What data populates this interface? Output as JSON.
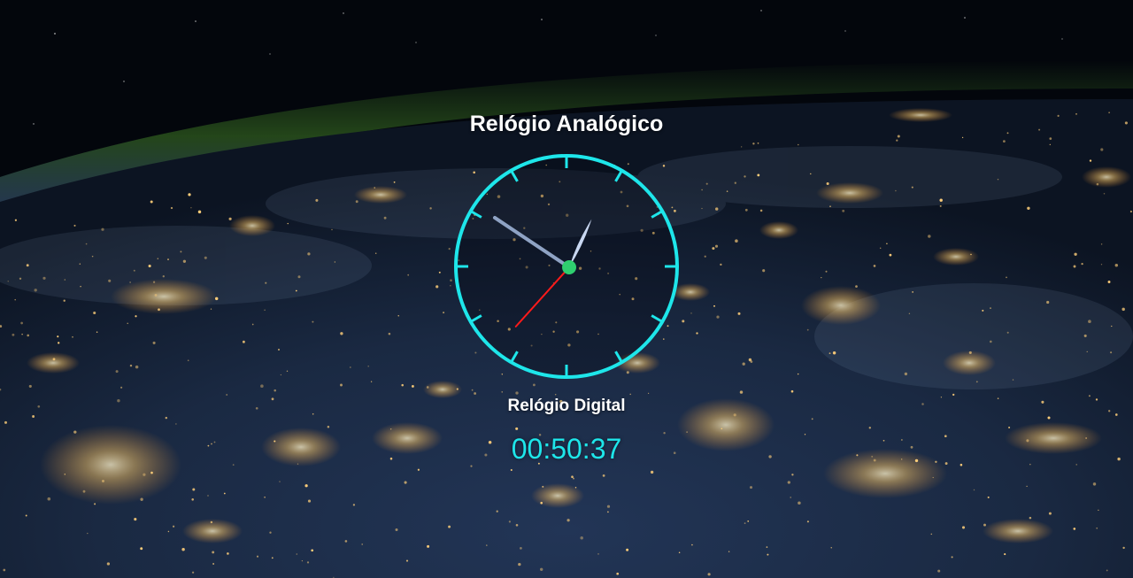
{
  "page": {
    "analog_title": "Relógio Analógico",
    "digital_title": "Relógio Digital",
    "digital_time": "00:50:37"
  },
  "clock": {
    "hours": 0,
    "minutes": 50,
    "seconds": 37,
    "ring_color": "#1ee6ea",
    "hour_hand_color": "#c9d8f2",
    "minute_hand_color": "#8fa3c4",
    "second_hand_color": "#ff1a1a",
    "center_color": "#2fcf6f"
  },
  "background": {
    "description_icon": "earth-night-from-space",
    "sky_color": "#03060c",
    "ocean_color": "#16253a",
    "atmosphere_color": "#2c5a1e",
    "city_light_color": "#ffcf7a"
  }
}
